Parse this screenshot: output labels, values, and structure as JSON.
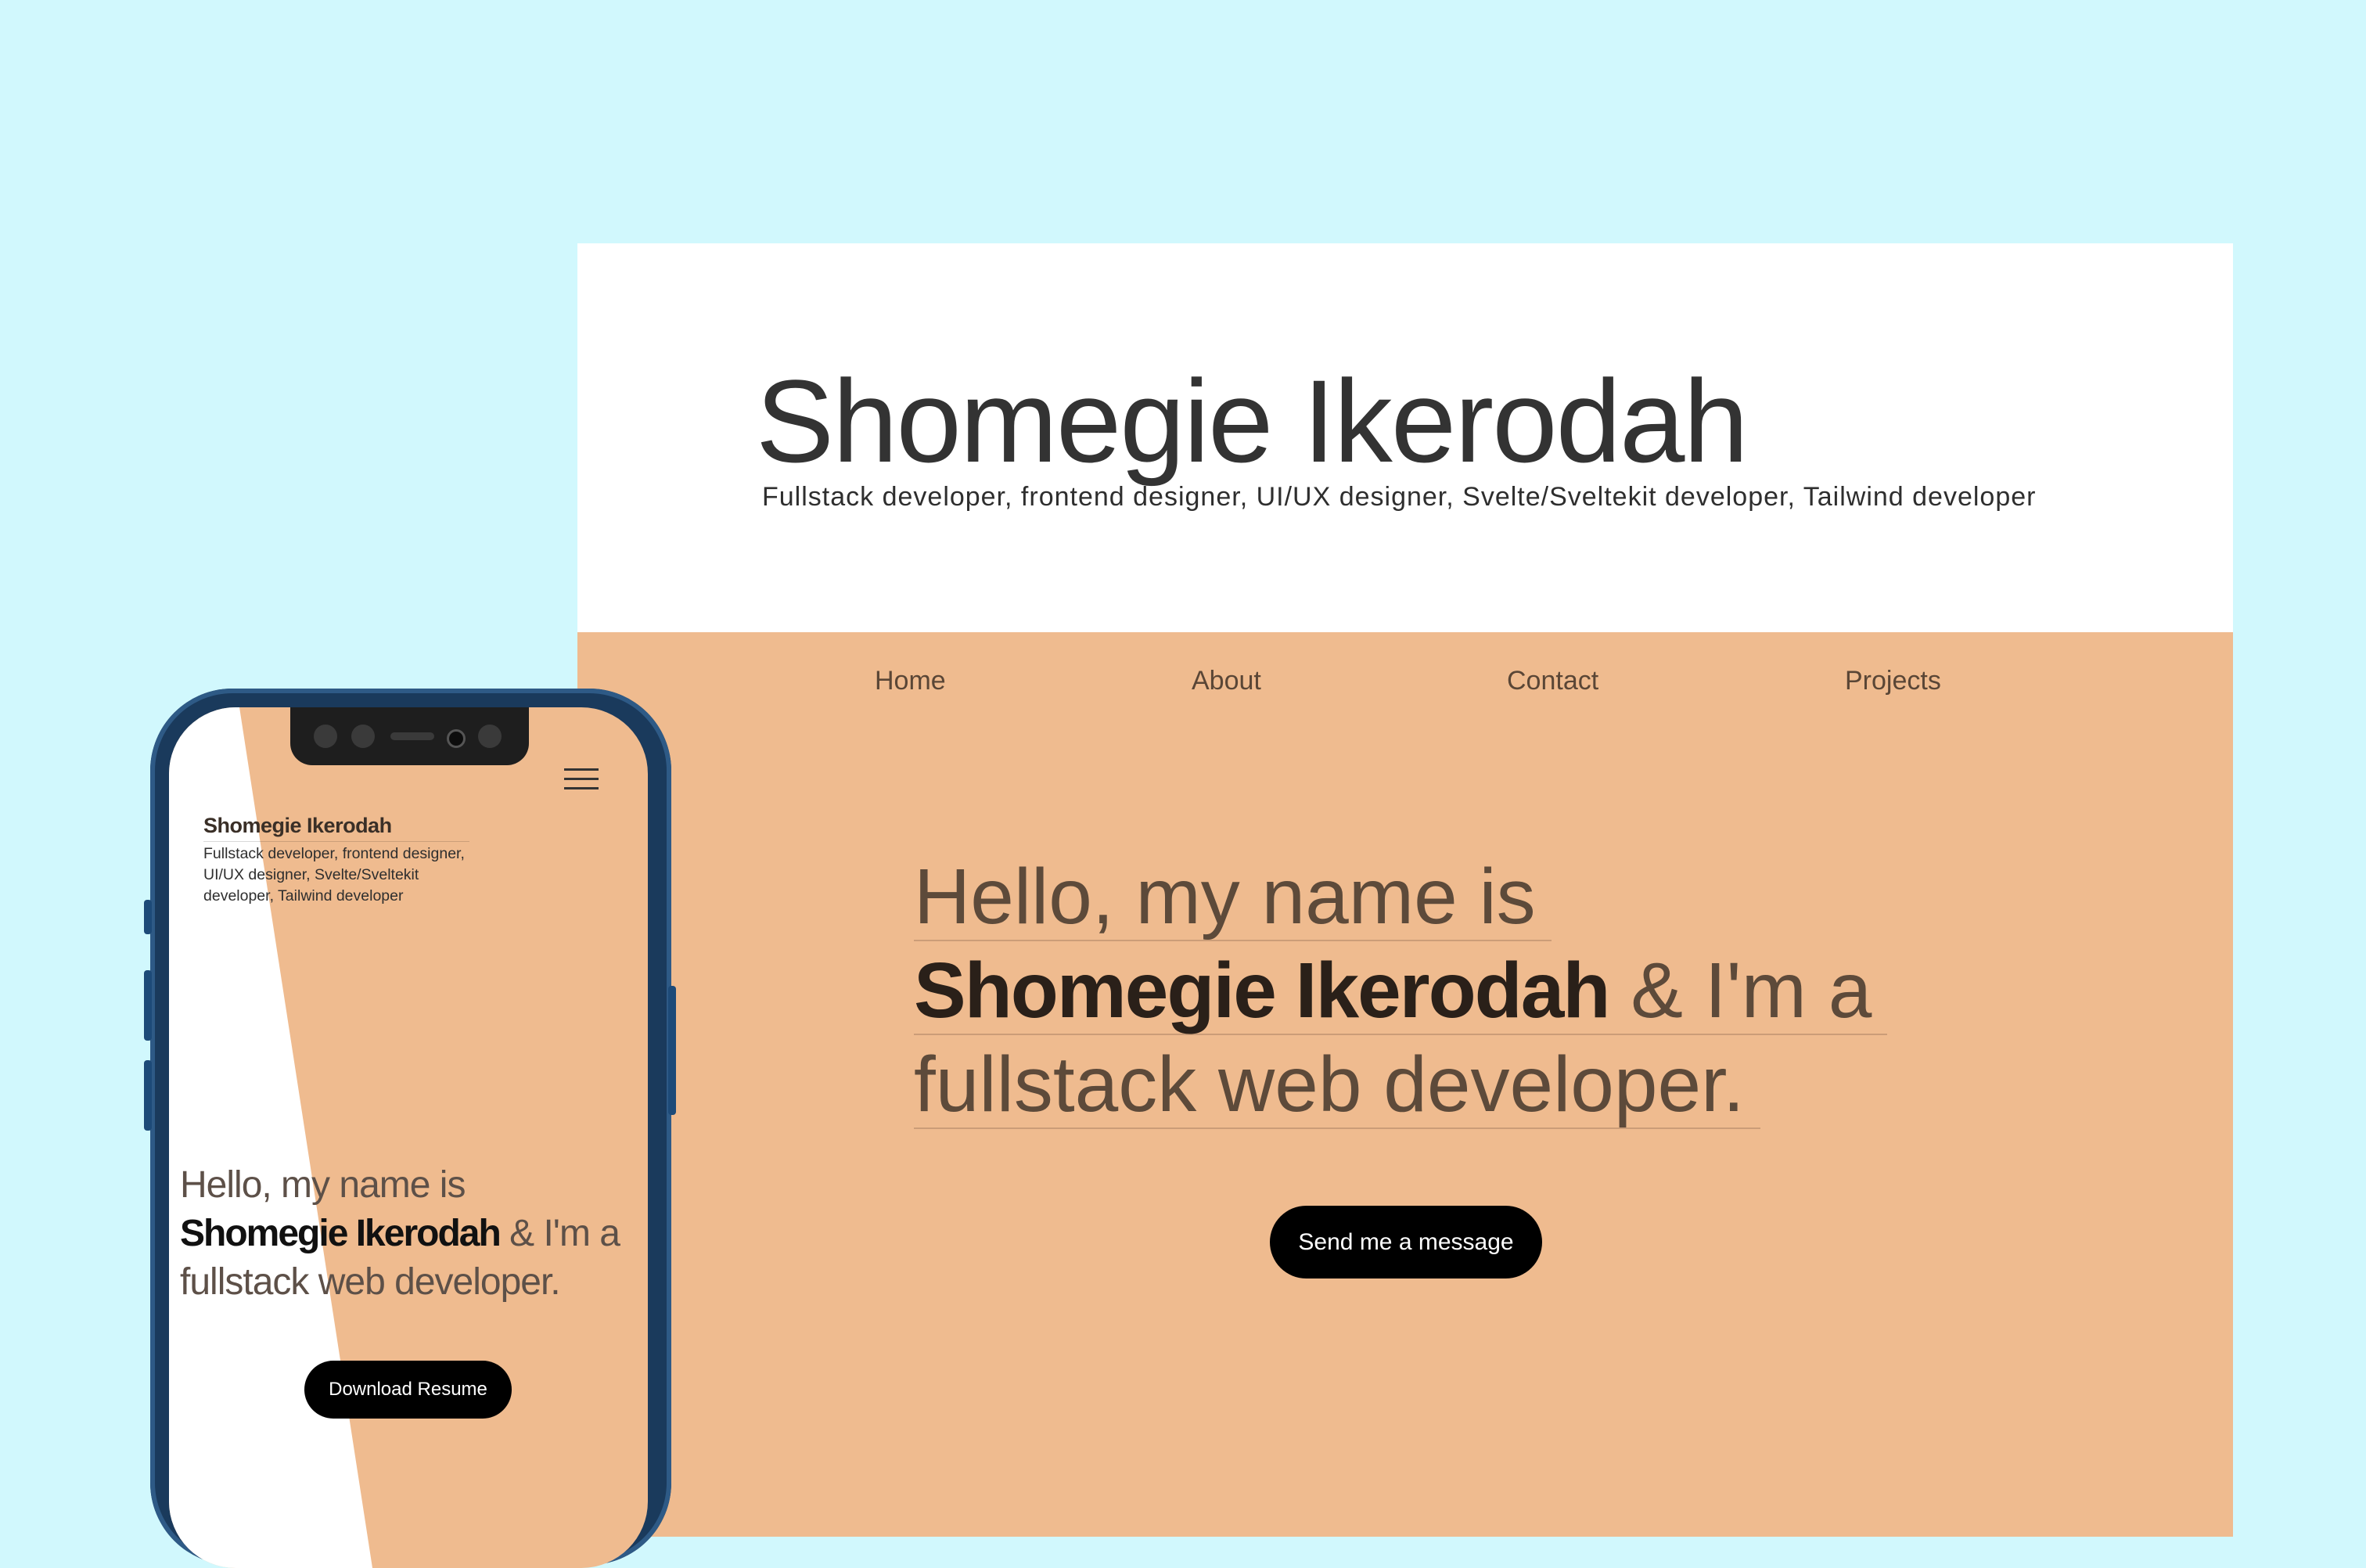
{
  "desktop": {
    "title": "Shomegie Ikerodah",
    "subtitle": "Fullstack developer, frontend designer, UI/UX designer, Svelte/Sveltekit developer, Tailwind developer",
    "nav": [
      "Home",
      "About",
      "Contact",
      "Projects"
    ],
    "hero": {
      "line1": "Hello, my name is",
      "name": "Shomegie Ikerodah",
      "line2_rest": " & I'm a",
      "line3": "fullstack web developer."
    },
    "cta": "Send me a message"
  },
  "mobile": {
    "title": "Shomegie Ikerodah",
    "subtitle": "Fullstack developer, frontend designer, UI/UX designer, Svelte/Sveltekit developer, Tailwind developer",
    "hero": {
      "line1": "Hello, my name is",
      "name": "Shomegie Ikerodah",
      "line2_rest": " & I'm a",
      "line3": "fullstack web developer."
    },
    "cta": "Download Resume"
  },
  "colors": {
    "background": "#d1f8fd",
    "accent": "#efbb8f",
    "button": "#000000"
  },
  "icons": {
    "menu": "hamburger-menu-icon"
  }
}
